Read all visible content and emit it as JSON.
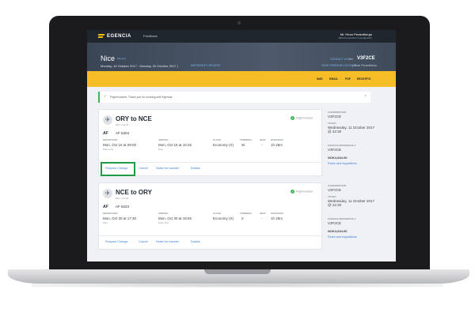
{
  "nav": {
    "logo": "EGENCIA",
    "feedback": "Feedback",
    "user_name": "Mr. Hiran Peramthirum",
    "user_sub": "MNN Peramthirum Headquarter"
  },
  "hero": {
    "title": "Nice",
    "badge": "Meeting",
    "dates": "Monday, 16 October 2017 - Monday, 30 October 2017 |",
    "info": "IMPORTANT UPDATES",
    "contact": "CONTACT US",
    "ref_label": "Ref:",
    "ref_code": "V3F2CE",
    "view": "VIEW ITINERARY DETAILS",
    "view2": "| Hiran Peramthirum"
  },
  "actions": [
    "SMS",
    "EMAIL",
    "PDF",
    "RECEIPTS"
  ],
  "alert": {
    "text": "Flight booked. Thank you for booking with Egencia."
  },
  "flights": [
    {
      "route": "ORY to NCE",
      "route_sub": "Mon, Oct 16",
      "status": "Flight booked",
      "airline": "AF",
      "flight_no": "AF 6204",
      "departure_label": "DEPARTURE",
      "departure": "Mon, Oct 16 at 09:00",
      "departure_sub": "Paris Orly",
      "arrival_label": "ARRIVAL",
      "arrival": "Mon, Oct 16 at 10:25",
      "arrival_sub": "Nice",
      "class_label": "CLASS",
      "class": "Economy (X)",
      "terminal_label": "TERMINAL",
      "terminal": "W",
      "seat_label": "SEAT",
      "seat": "-",
      "duration_label": "DURATION",
      "duration": "1h 25m",
      "links": [
        "Request Change",
        "Cancel",
        "Notes for traveler",
        "Details"
      ]
    },
    {
      "route": "NCE to ORY",
      "route_sub": "Mon, Oct 30",
      "status": "Flight booked",
      "airline": "AF",
      "flight_no": "AF 6223",
      "departure_label": "DEPARTURE",
      "departure": "Mon, Oct 30 at 17:30",
      "departure_sub": "Nice",
      "arrival_label": "ARRIVAL",
      "arrival": "Mon, Oct 30 at 18:55",
      "arrival_sub": "Paris Orly",
      "class_label": "CLASS",
      "class": "Economy (X)",
      "terminal_label": "TERMINAL",
      "terminal": "2",
      "seat_label": "SEAT",
      "seat": "-",
      "duration_label": "DURATION",
      "duration": "1h 25m",
      "links": [
        "Request Change",
        "Cancel",
        "Notes for traveler",
        "Details"
      ]
    }
  ],
  "side": [
    {
      "confirmation_label": "CONFIRMATION",
      "confirmation": "V3F2CE",
      "ticket_label": "TICKET",
      "ticket": "Wednesday, 11 October 2017 @ 22:30",
      "egencia_label": "EGENCIA REFERENCE #",
      "egencia": "V3F2CE",
      "price": "NOK4,844.00",
      "rules": "Rules and regulations"
    },
    {
      "confirmation_label": "CONFIRMATION",
      "confirmation": "V3F2CE",
      "ticket_label": "TICKET",
      "ticket": "Wednesday, 11 October 2017 @ 22:30",
      "egencia_label": "EGENCIA REFERENCE #",
      "egencia": "V3F2CE",
      "price": "NOK4,844.00",
      "rules": "Rules and regulations"
    }
  ],
  "colors": {
    "nav_bg": "#20262e",
    "accent_yellow": "#f6bd26",
    "success_green": "#3fb55c",
    "link_blue": "#3d7fcf",
    "highlight_green": "#1e9b45"
  },
  "icons": {
    "logo": "egencia-logo-icon",
    "plane": "plane-icon",
    "check": "check-icon",
    "close": "close-icon",
    "chevron": "chevron-down-icon"
  }
}
